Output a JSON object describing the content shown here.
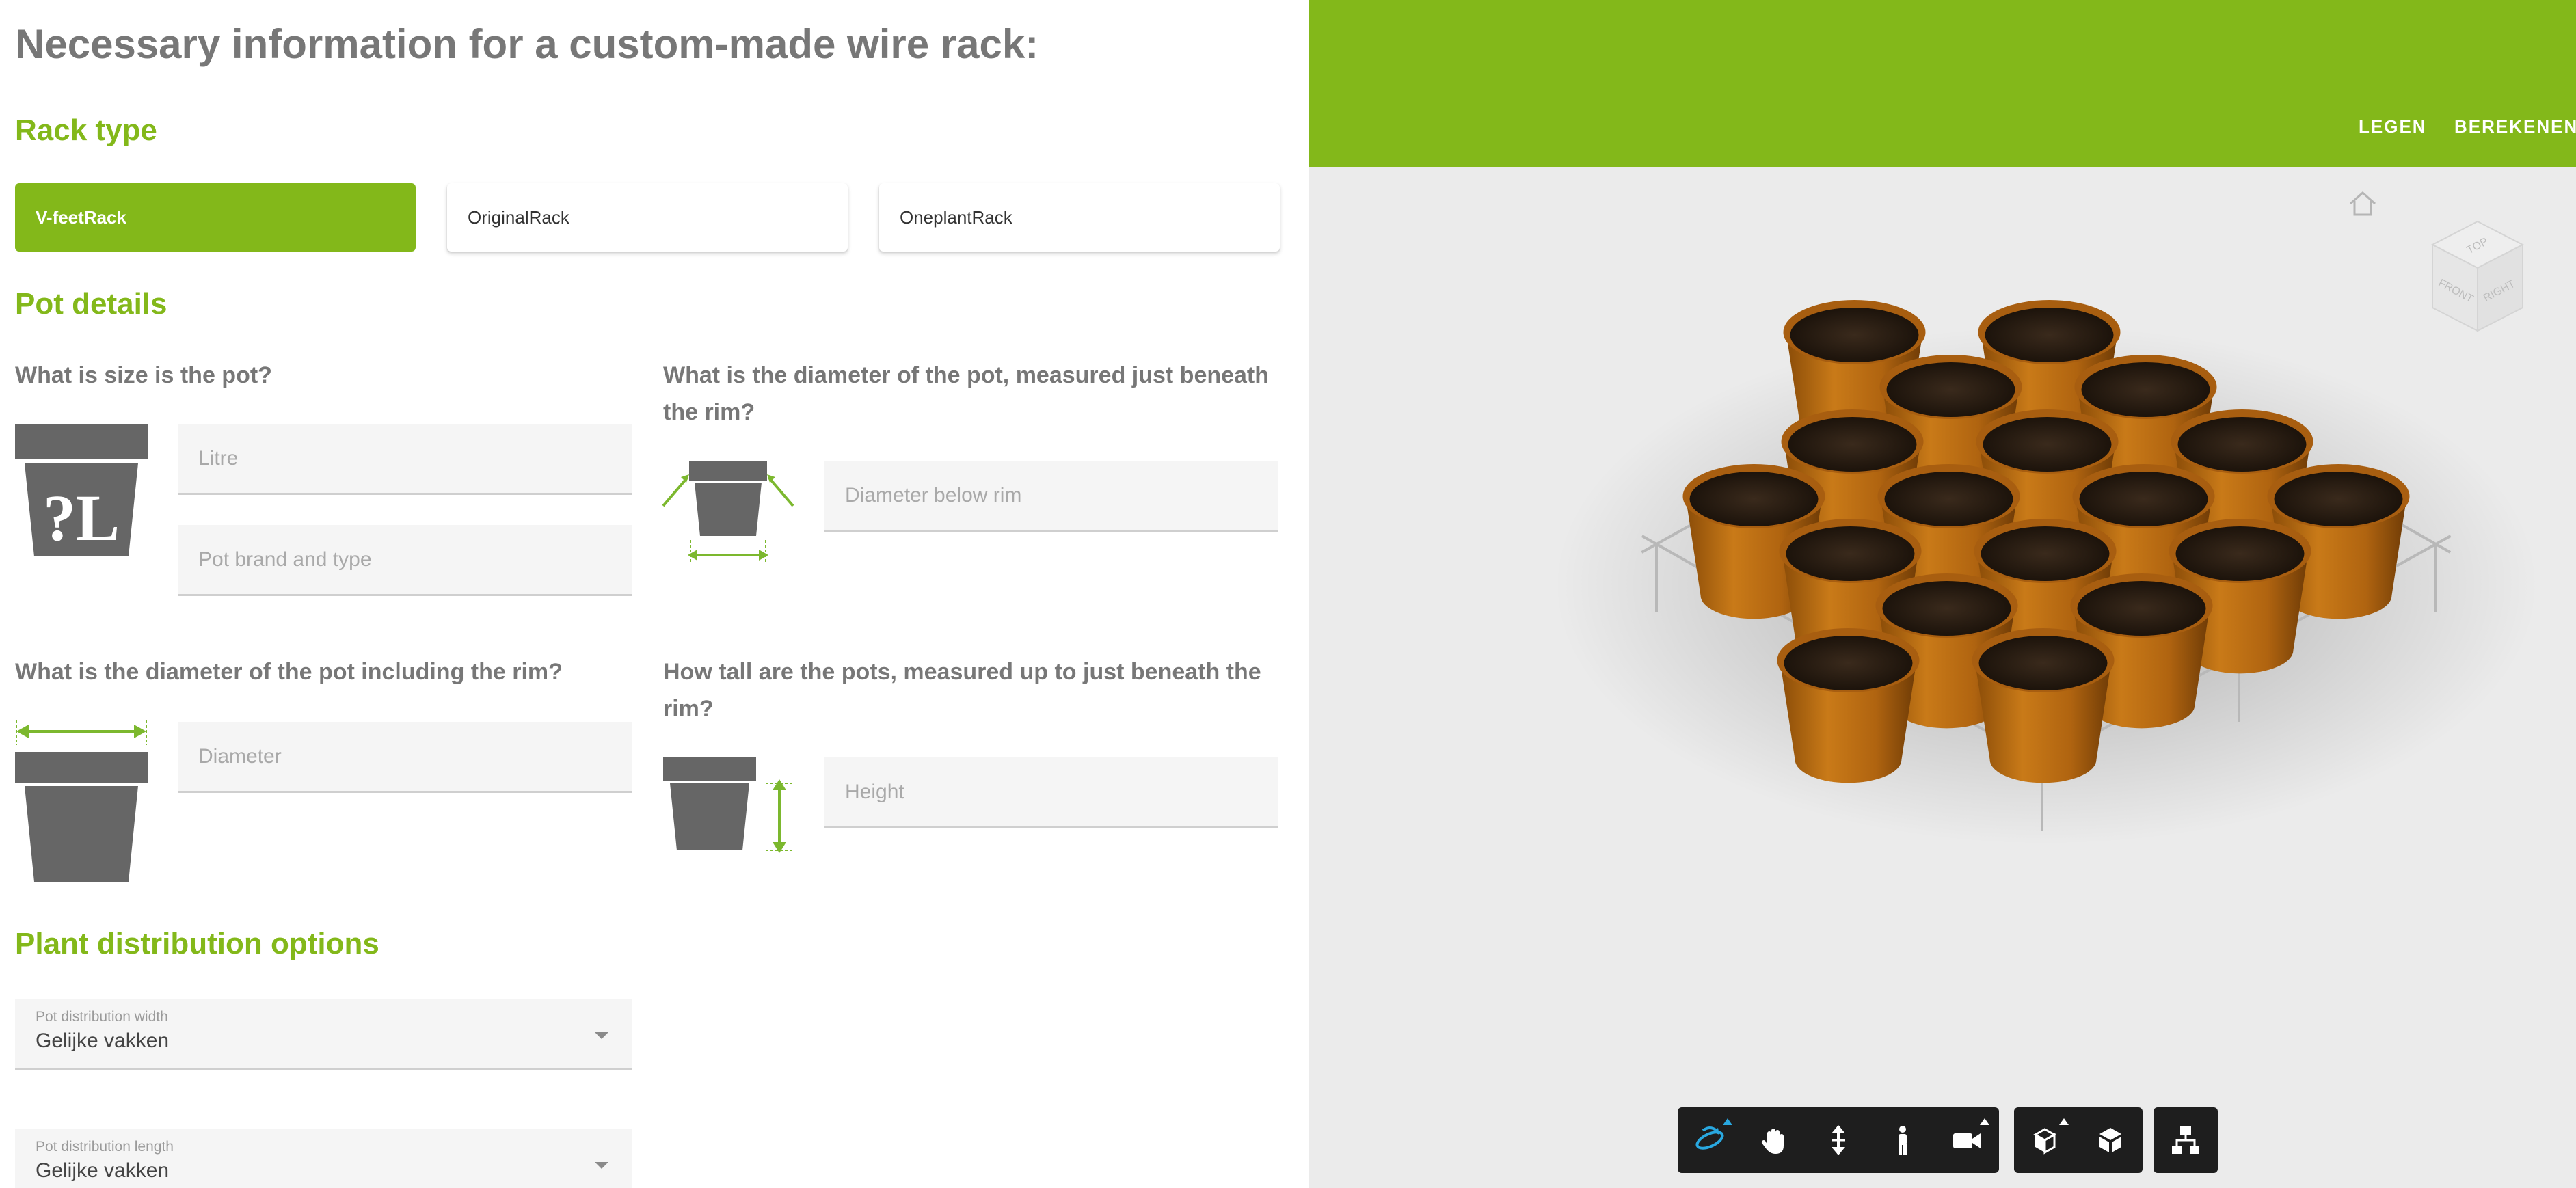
{
  "page_title": "Necessary information for a custom-made wire rack:",
  "rack_type": {
    "heading": "Rack type",
    "options": [
      {
        "label": "V-feetRack",
        "selected": true
      },
      {
        "label": "OriginalRack",
        "selected": false
      },
      {
        "label": "OneplantRack",
        "selected": false
      }
    ]
  },
  "pot_details": {
    "heading": "Pot details",
    "size": {
      "question": "What is size is the pot?",
      "icon_text": "?L",
      "litre_placeholder": "Litre",
      "brand_placeholder": "Pot brand and type"
    },
    "diameter_below_rim": {
      "question": "What is the diameter of the pot, measured just beneath the rim?",
      "placeholder": "Diameter below rim"
    },
    "diameter_incl_rim": {
      "question": "What is the diameter of the pot including the rim?",
      "placeholder": "Diameter"
    },
    "height": {
      "question": "How tall are the pots, measured up to just beneath the rim?",
      "placeholder": "Height"
    }
  },
  "distribution": {
    "heading": "Plant distribution options",
    "width": {
      "label": "Pot distribution width",
      "value": "Gelijke vakken"
    },
    "length": {
      "label": "Pot distribution length",
      "value": "Gelijke vakken"
    }
  },
  "viewer": {
    "actions": {
      "clear": "LEGEN",
      "calculate": "BEREKENEN"
    },
    "viewcube": {
      "top": "TOP",
      "front": "FRONT",
      "right": "RIGHT"
    },
    "toolbar": [
      {
        "group": 1,
        "items": [
          "orbit-icon",
          "pan-icon",
          "zoom-icon",
          "walk-icon",
          "camera-icon"
        ]
      },
      {
        "group": 2,
        "items": [
          "explode-icon",
          "model-icon"
        ]
      },
      {
        "group": 3,
        "items": [
          "structure-icon"
        ]
      }
    ],
    "active_tool": "orbit-icon"
  },
  "colors": {
    "accent": "#83b81a",
    "heading_gray": "#777777",
    "pot_orange": "#b86a12",
    "soil": "#2b1d12",
    "wire": "#b5b5b5",
    "toolbar": "#1e1e1e",
    "active_tool": "#29a8e0"
  }
}
